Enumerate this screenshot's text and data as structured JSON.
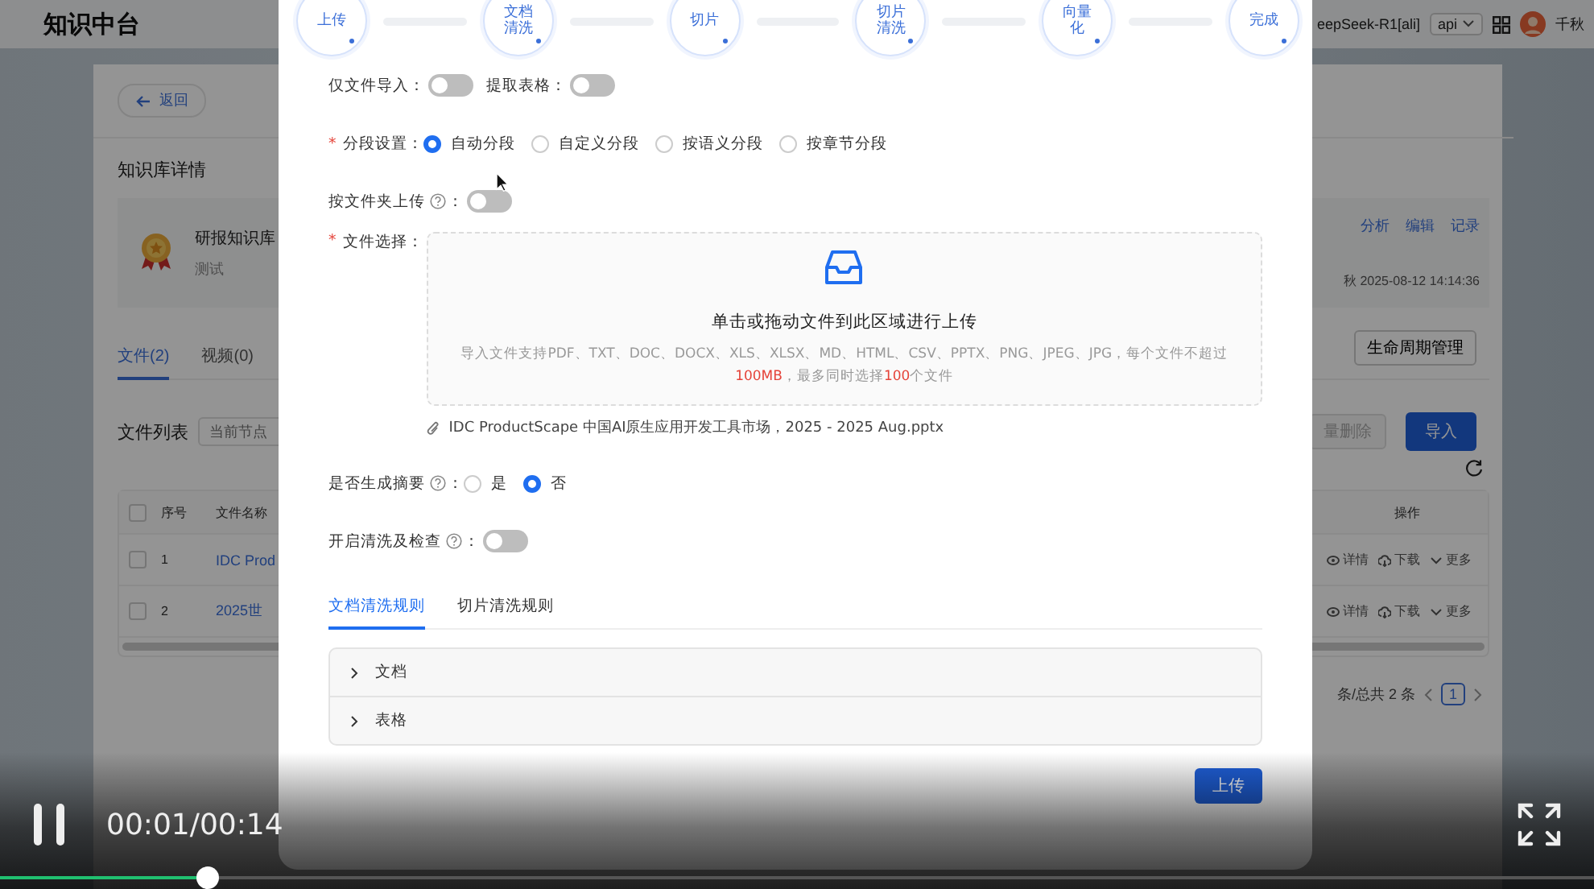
{
  "header": {
    "title": "知识中台",
    "model_select": "eepSeek-R1[ali]",
    "api_select": "api",
    "user_name": "千秋"
  },
  "page": {
    "back_button": "返回",
    "section_title": "知识库详情",
    "kb": {
      "name": "研报知识库",
      "description": "测试",
      "actions": [
        "分析",
        "编辑",
        "记录"
      ],
      "updated": "秋 2025-08-12 14:14:36"
    },
    "tabs": [
      {
        "label": "文件(2)",
        "selected": true
      },
      {
        "label": "视频(0)",
        "selected": false
      }
    ],
    "lifecycle_button": "生命周期管理",
    "file_list": {
      "title": "文件列表",
      "search_placeholder": "当前节点",
      "delete_button": "量删除",
      "import_button": "导入"
    },
    "table": {
      "columns": [
        "序号",
        "文件名称",
        "操作"
      ],
      "select_all_checked": false,
      "rows": [
        {
          "index": "1",
          "name": "IDC Prod",
          "checked": false,
          "actions": [
            "详情",
            "下载",
            "更多"
          ]
        },
        {
          "index": "2",
          "name": "2025世",
          "checked": false,
          "actions": [
            "详情",
            "下载",
            "更多"
          ]
        }
      ]
    },
    "pagination": {
      "summary": "条/总共 2 条",
      "pages": [
        {
          "label": "1",
          "selected": true
        }
      ]
    }
  },
  "modal": {
    "steps": [
      {
        "label": "上传"
      },
      {
        "label": "文档清洗"
      },
      {
        "label": "切片"
      },
      {
        "label": "切片清洗"
      },
      {
        "label": "向量化"
      },
      {
        "label": "完成"
      }
    ],
    "rows": [
      {
        "kind": "switches",
        "items": [
          {
            "label": "仅文件导入：",
            "on": false
          },
          {
            "label": "提取表格：",
            "on": false
          }
        ]
      },
      {
        "kind": "radios",
        "required_mark": "*",
        "label": "分段设置：",
        "options": [
          {
            "label": "自动分段",
            "selected": true
          },
          {
            "label": "自定义分段",
            "selected": false
          },
          {
            "label": "按语义分段",
            "selected": false
          },
          {
            "label": "按章节分段",
            "selected": false
          }
        ]
      },
      {
        "kind": "switches",
        "items": [
          {
            "label": "按文件夹上传",
            "help": true,
            "suffix": "：",
            "on": false
          }
        ]
      },
      {
        "kind": "upload",
        "required_mark": "*",
        "label": "文件选择：",
        "title": "单击或拖动文件到此区域进行上传",
        "hint": [
          {
            "text": "导入文件支持PDF、TXT、DOC、DOCX、XLS、XLSX、MD、HTML、CSV、PPTX、PNG、JPEG、JPG，每个文件不超过",
            "accent": false
          },
          {
            "text": "100MB",
            "accent": true
          },
          {
            "text": "，最多同时选择",
            "accent": false
          },
          {
            "text": "100",
            "accent": true
          },
          {
            "text": "个文件",
            "accent": false
          }
        ],
        "files": [
          "IDC ProductScape 中国AI原生应用开发工具市场，2025 - 2025 Aug.pptx"
        ]
      },
      {
        "kind": "radios",
        "label": "是否生成摘要",
        "help": true,
        "suffix": "：",
        "options": [
          {
            "label": "是",
            "selected": false
          },
          {
            "label": "否",
            "selected": true
          }
        ]
      },
      {
        "kind": "switches",
        "items": [
          {
            "label": "开启清洗及检查",
            "help": true,
            "suffix": "：",
            "on": false
          }
        ]
      }
    ],
    "tabs": [
      {
        "label": "文档清洗规则",
        "selected": true
      },
      {
        "label": "切片清洗规则",
        "selected": false
      }
    ],
    "panels": [
      {
        "label": "文档",
        "expanded": false
      },
      {
        "label": "表格",
        "expanded": false
      }
    ],
    "submit_button": "上传"
  },
  "video": {
    "playing": true,
    "time": "00:01/00:14",
    "level": 0.13
  }
}
